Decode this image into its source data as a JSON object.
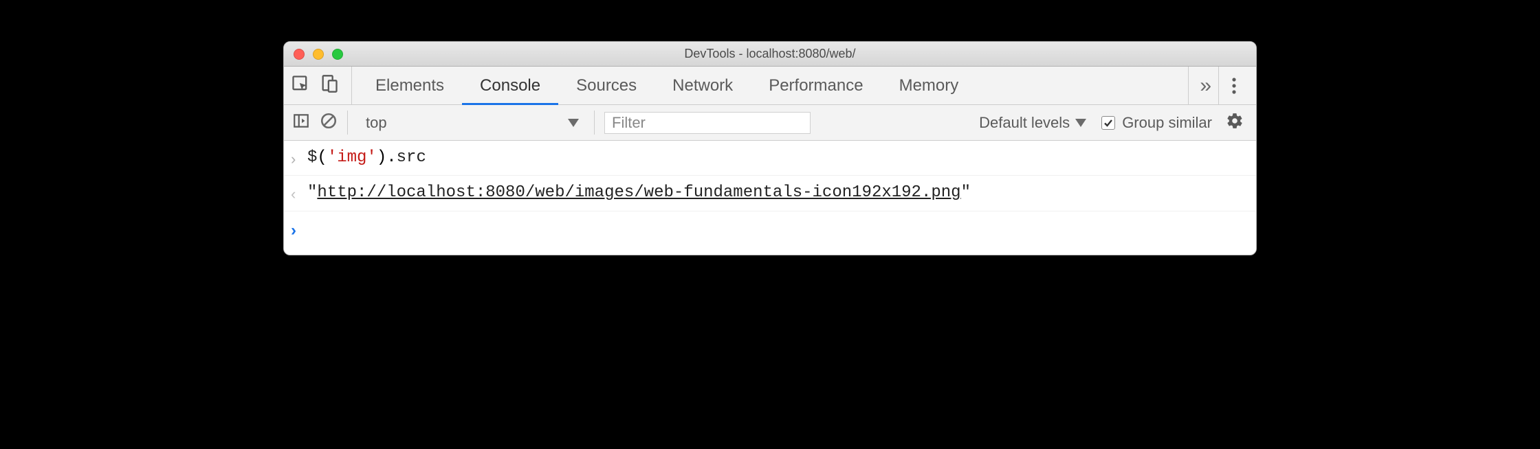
{
  "window": {
    "title": "DevTools - localhost:8080/web/"
  },
  "tabs": {
    "items": [
      "Elements",
      "Console",
      "Sources",
      "Network",
      "Performance",
      "Memory"
    ],
    "active_index": 1
  },
  "toolbar": {
    "context": "top",
    "filter_placeholder": "Filter",
    "filter_value": "",
    "levels_label": "Default levels",
    "group_similar_label": "Group similar",
    "group_similar_checked": true
  },
  "console": {
    "input_line": {
      "fn": "$",
      "open": "(",
      "arg": "'img'",
      "close": ").",
      "prop": "src"
    },
    "result_line": {
      "quote_open": "\"",
      "url": "http://localhost:8080/web/images/web-fundamentals-icon192x192.png",
      "quote_close": "\""
    }
  }
}
